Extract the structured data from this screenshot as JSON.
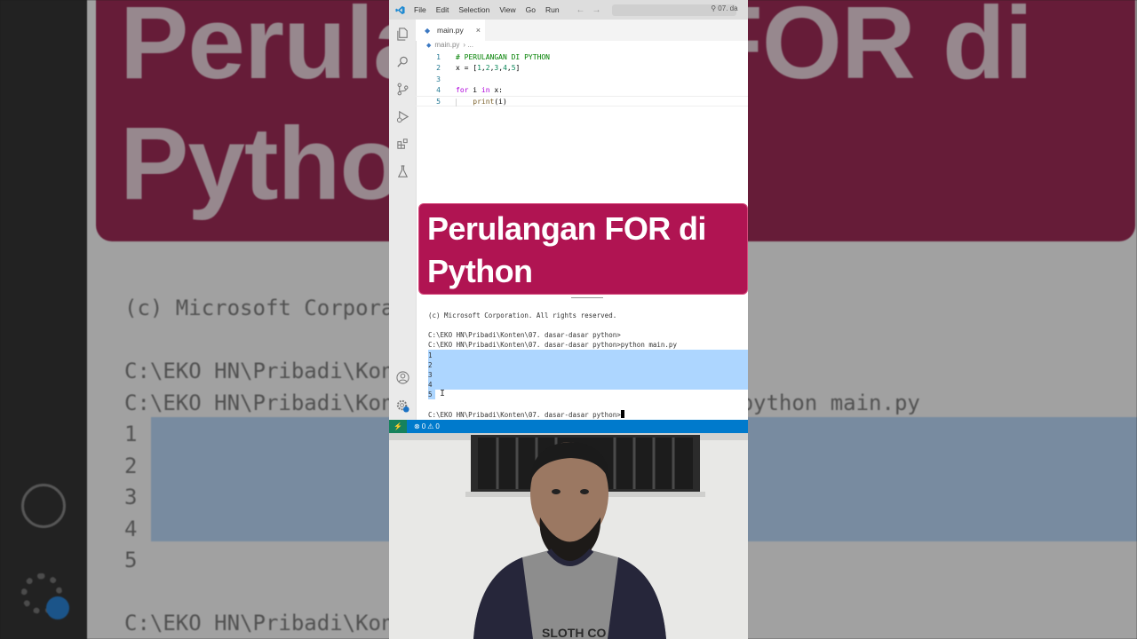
{
  "background": {
    "banner_text": "Perulangan FOR di Python",
    "term_lines": [
      "(c) Microsoft Corporation. All rights reserved.",
      "",
      "C:\\EKO HN\\Pribadi\\Konten\\07. dasar-dasar python>",
      "C:\\EKO HN\\Pribadi\\Konten\\07. dasar-dasar python>python main.py",
      "1",
      "2",
      "3",
      "4",
      "5",
      "",
      "C:\\EKO HN\\Pribadi\\Konten\\07. dasar-dasar python>"
    ]
  },
  "titlebar": {
    "menu": [
      "File",
      "Edit",
      "Selection",
      "View",
      "Go",
      "Run"
    ],
    "search_text": "07. da"
  },
  "tab": {
    "label": "main.py",
    "close": "×"
  },
  "breadcrumb": {
    "file": "main.py",
    "sep": "› ..."
  },
  "code": {
    "line_numbers": [
      "1",
      "2",
      "3",
      "4",
      "5"
    ],
    "lines": [
      {
        "parts": [
          {
            "t": "# PERULANGAN DI PYTHON",
            "c": "comment"
          }
        ]
      },
      {
        "parts": [
          {
            "t": "x = [",
            "c": "def"
          },
          {
            "t": "1",
            "c": "num"
          },
          {
            "t": ",",
            "c": "def"
          },
          {
            "t": "2",
            "c": "num"
          },
          {
            "t": ",",
            "c": "def"
          },
          {
            "t": "3",
            "c": "num"
          },
          {
            "t": ",",
            "c": "def"
          },
          {
            "t": "4",
            "c": "num"
          },
          {
            "t": ",",
            "c": "def"
          },
          {
            "t": "5",
            "c": "num"
          },
          {
            "t": "]",
            "c": "def"
          }
        ]
      },
      {
        "parts": []
      },
      {
        "parts": [
          {
            "t": "for",
            "c": "kw"
          },
          {
            "t": " i ",
            "c": "def"
          },
          {
            "t": "in",
            "c": "kw"
          },
          {
            "t": " x:",
            "c": "def"
          }
        ]
      },
      {
        "parts": [
          {
            "t": "    ",
            "c": "def"
          },
          {
            "t": "print",
            "c": "fn"
          },
          {
            "t": "(i)",
            "c": "def"
          }
        ]
      }
    ]
  },
  "overlay": {
    "line1": "Perulangan FOR di",
    "line2": "Python"
  },
  "terminal": {
    "copyright": "(c) Microsoft Corporation. All rights reserved.",
    "prompt1": "C:\\EKO HN\\Pribadi\\Konten\\07. dasar-dasar python>",
    "prompt2": "C:\\EKO HN\\Pribadi\\Konten\\07. dasar-dasar python>python main.py",
    "outputs": [
      "1",
      "2",
      "3",
      "4",
      "5"
    ],
    "prompt3": "C:\\EKO HN\\Pribadi\\Konten\\07. dasar-dasar python>"
  },
  "statusbar": {
    "errors": "0",
    "warnings": "0"
  },
  "webcam": {
    "shirt_text": "SLOTH CO"
  },
  "colors": {
    "overlay": "#b01452",
    "statusbar": "#007acc",
    "selection": "#add6ff",
    "remote": "#16825d"
  }
}
